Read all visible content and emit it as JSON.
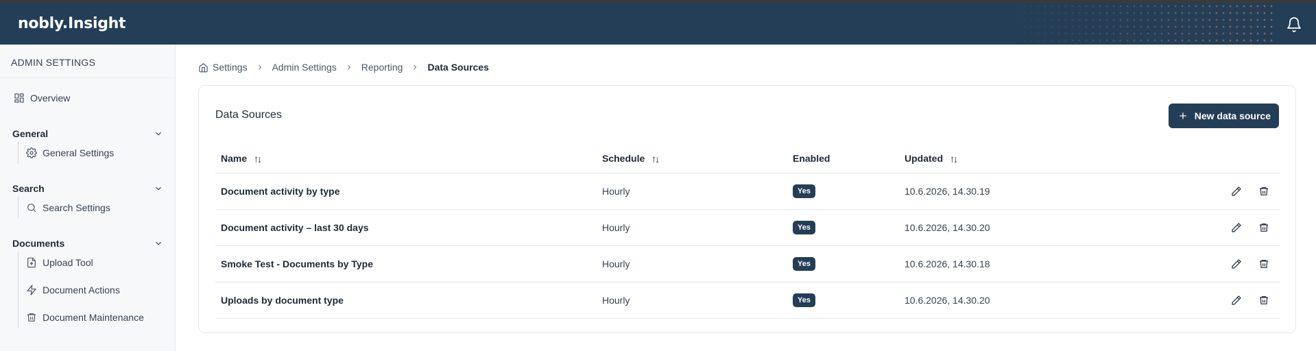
{
  "app": {
    "logo": "nobly.Insight"
  },
  "sidebar": {
    "title": "ADMIN SETTINGS",
    "overview": "Overview",
    "groups": [
      {
        "label": "General",
        "items": [
          "General Settings"
        ]
      },
      {
        "label": "Search",
        "items": [
          "Search Settings"
        ]
      },
      {
        "label": "Documents",
        "items": [
          "Upload Tool",
          "Document Actions",
          "Document Maintenance"
        ]
      }
    ]
  },
  "breadcrumb": [
    "Settings",
    "Admin Settings",
    "Reporting",
    "Data Sources"
  ],
  "card": {
    "title": "Data Sources",
    "new_button": "New data source"
  },
  "table": {
    "columns": [
      "Name",
      "Schedule",
      "Enabled",
      "Updated"
    ],
    "rows": [
      {
        "name": "Document activity by type",
        "schedule": "Hourly",
        "enabled": "Yes",
        "updated": "10.6.2026, 14.30.19"
      },
      {
        "name": "Document activity – last 30 days",
        "schedule": "Hourly",
        "enabled": "Yes",
        "updated": "10.6.2026, 14.30.20"
      },
      {
        "name": "Smoke Test - Documents by Type",
        "schedule": "Hourly",
        "enabled": "Yes",
        "updated": "10.6.2026, 14.30.18"
      },
      {
        "name": "Uploads by document type",
        "schedule": "Hourly",
        "enabled": "Yes",
        "updated": "10.6.2026, 14.30.20"
      }
    ]
  },
  "colors": {
    "brand": "#243e57",
    "accent_dots": "#e68c46"
  }
}
